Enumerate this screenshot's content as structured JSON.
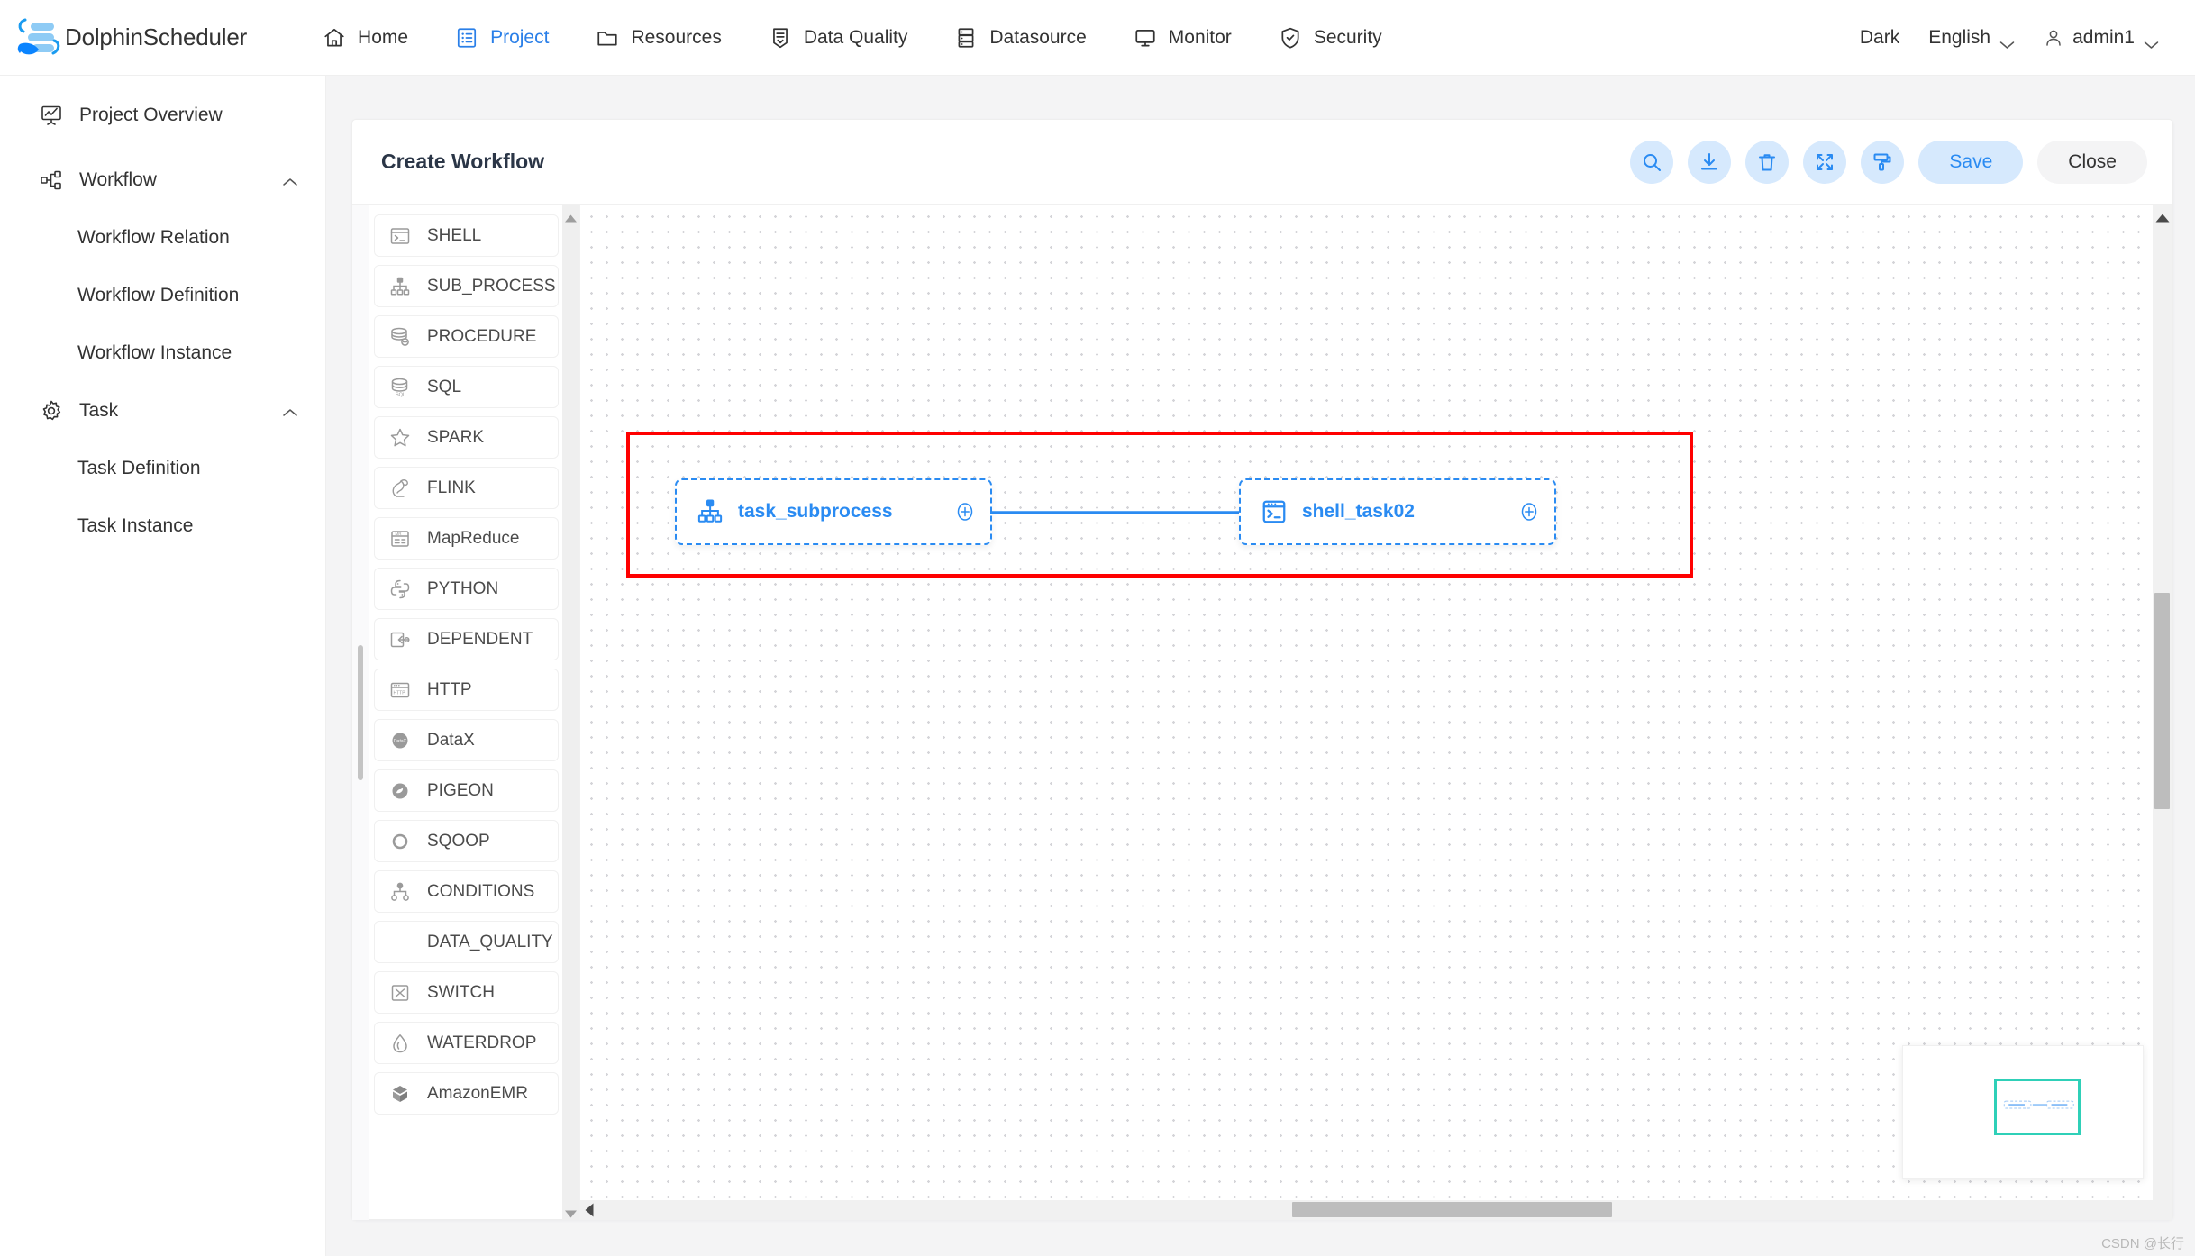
{
  "header": {
    "brand_name": "DolphinScheduler",
    "logo_icon": "dolphin-logo-icon",
    "nav": [
      {
        "label": "Home",
        "icon": "home-icon",
        "active": false
      },
      {
        "label": "Project",
        "icon": "project-icon",
        "active": true
      },
      {
        "label": "Resources",
        "icon": "folder-icon",
        "active": false
      },
      {
        "label": "Data Quality",
        "icon": "data-quality-icon",
        "active": false
      },
      {
        "label": "Datasource",
        "icon": "datasource-icon",
        "active": false
      },
      {
        "label": "Monitor",
        "icon": "monitor-icon",
        "active": false
      },
      {
        "label": "Security",
        "icon": "shield-icon",
        "active": false
      }
    ],
    "theme_label": "Dark",
    "language_label": "English",
    "language_caret_icon": "chevron-down-icon",
    "user_icon": "user-icon",
    "user_name": "admin1",
    "user_caret_icon": "chevron-down-icon",
    "active_color": "#2a7fe8"
  },
  "sidebar": {
    "items": [
      {
        "label": "Project Overview",
        "icon": "overview-icon",
        "level": "top",
        "caret": ""
      },
      {
        "label": "Workflow",
        "icon": "workflow-icon",
        "level": "top",
        "caret": "chevron-up-icon"
      },
      {
        "label": "Workflow Relation",
        "icon": "",
        "level": "child",
        "caret": ""
      },
      {
        "label": "Workflow Definition",
        "icon": "",
        "level": "child",
        "caret": ""
      },
      {
        "label": "Workflow Instance",
        "icon": "",
        "level": "child",
        "caret": ""
      },
      {
        "label": "Task",
        "icon": "gear-icon",
        "level": "top",
        "caret": "chevron-up-icon"
      },
      {
        "label": "Task Definition",
        "icon": "",
        "level": "child",
        "caret": ""
      },
      {
        "label": "Task Instance",
        "icon": "",
        "level": "child",
        "caret": ""
      }
    ]
  },
  "panel": {
    "title": "Create Workflow",
    "toolbar": {
      "icon_buttons": [
        {
          "name": "search-button",
          "icon": "search-icon"
        },
        {
          "name": "download-button",
          "icon": "download-icon"
        },
        {
          "name": "delete-button",
          "icon": "trash-icon"
        },
        {
          "name": "fullscreen-button",
          "icon": "fullscreen-icon"
        },
        {
          "name": "format-button",
          "icon": "paint-roller-icon"
        }
      ],
      "save_label": "Save",
      "close_label": "Close",
      "accent_color": "#2a8bf2",
      "button_bg": "#d6e9fd"
    }
  },
  "palette": {
    "items": [
      {
        "label": "SHELL",
        "icon": "terminal-icon"
      },
      {
        "label": "SUB_PROCESS",
        "icon": "hierarchy-icon"
      },
      {
        "label": "PROCEDURE",
        "icon": "database-procedure-icon"
      },
      {
        "label": "SQL",
        "icon": "database-sql-icon"
      },
      {
        "label": "SPARK",
        "icon": "spark-star-icon"
      },
      {
        "label": "FLINK",
        "icon": "flink-squirrel-icon"
      },
      {
        "label": "MapReduce",
        "icon": "mapreduce-icon"
      },
      {
        "label": "PYTHON",
        "icon": "python-icon"
      },
      {
        "label": "DEPENDENT",
        "icon": "dependent-icon"
      },
      {
        "label": "HTTP",
        "icon": "http-icon"
      },
      {
        "label": "DataX",
        "icon": "datax-icon"
      },
      {
        "label": "PIGEON",
        "icon": "pigeon-icon"
      },
      {
        "label": "SQOOP",
        "icon": "sqoop-icon"
      },
      {
        "label": "CONDITIONS",
        "icon": "conditions-icon"
      },
      {
        "label": "DATA_QUALITY",
        "icon": ""
      },
      {
        "label": "SWITCH",
        "icon": "switch-icon"
      },
      {
        "label": "WATERDROP",
        "icon": "waterdrop-icon"
      },
      {
        "label": "AmazonEMR",
        "icon": "amazon-emr-icon"
      }
    ],
    "scroll_up_icon": "triangle-up-icon",
    "scroll_down_icon": "triangle-down-icon"
  },
  "canvas": {
    "nodes": [
      {
        "id": "task_subprocess",
        "label": "task_subprocess",
        "icon": "hierarchy-icon",
        "port_icon": "plus-circle-icon"
      },
      {
        "id": "shell_task02",
        "label": "shell_task02",
        "icon": "terminal-icon",
        "port_icon": "plus-circle-icon"
      }
    ],
    "edge": {
      "from": "task_subprocess",
      "to": "shell_task02",
      "color": "#2a8bf2"
    },
    "annotation_box_color": "#ff0000",
    "node_border_color": "#2a8bf2",
    "grid_dot_color": "#d4d4d8",
    "vertical_scroll_arrow_icon": "triangle-up-icon",
    "horizontal_scroll_arrow_icon": "triangle-left-icon"
  },
  "minimap": {
    "viewport_color": "#2fd0b8"
  },
  "watermark": "CSDN @长行"
}
